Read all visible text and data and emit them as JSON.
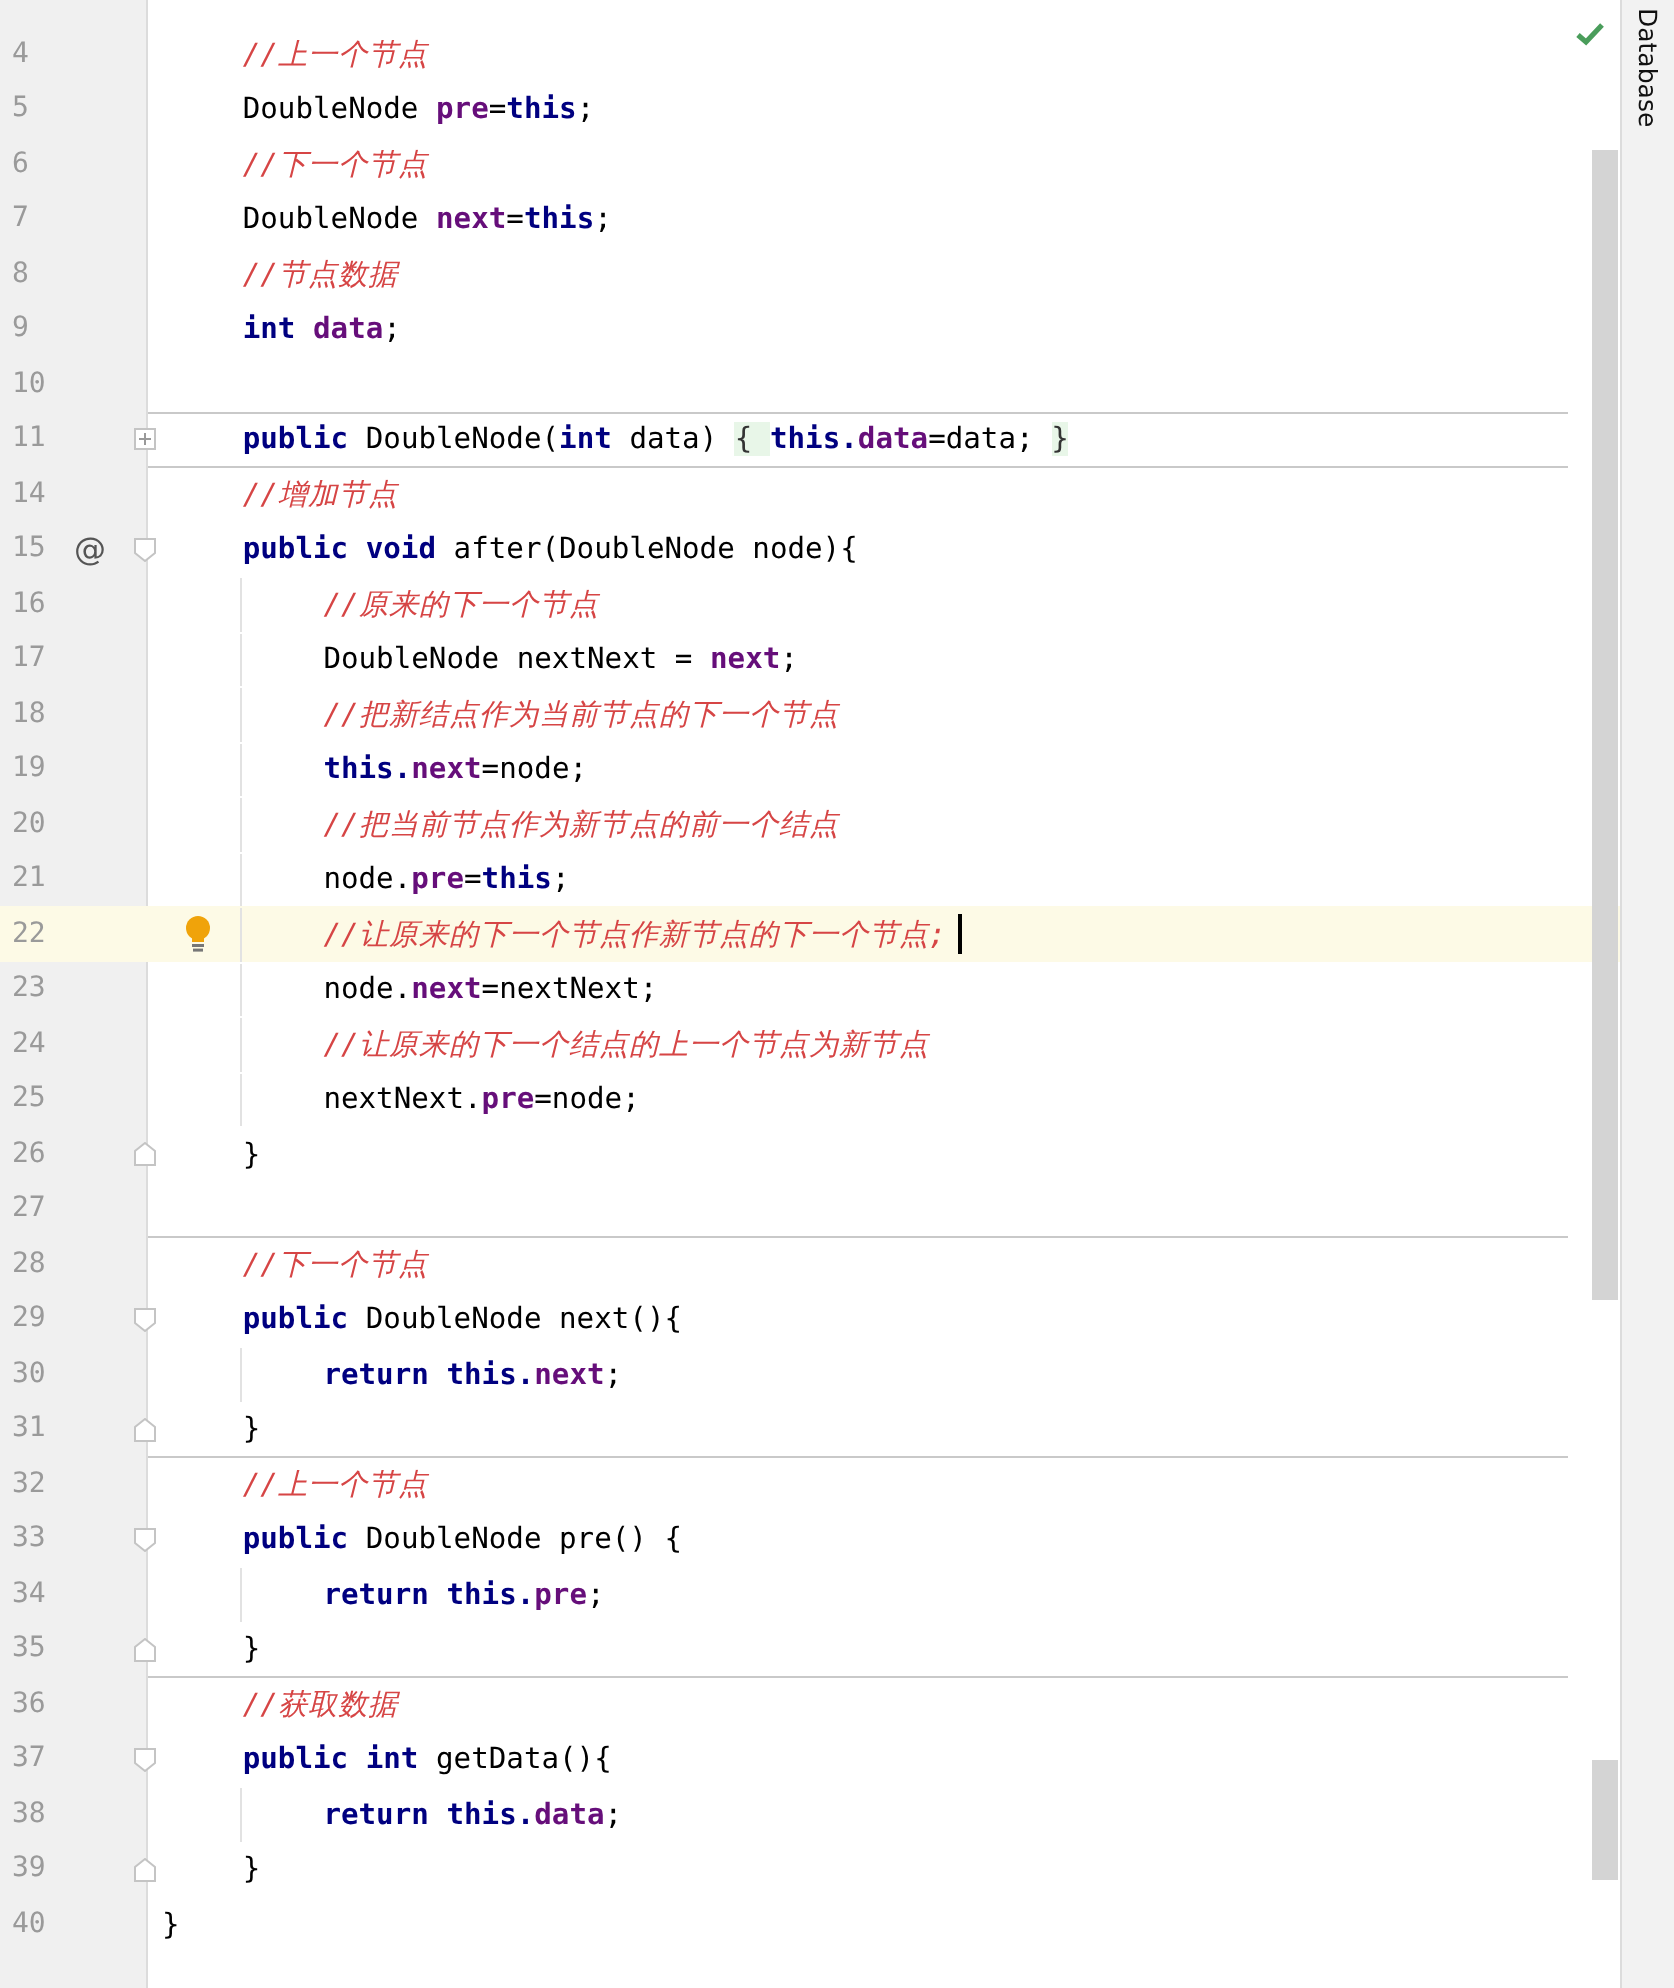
{
  "editor": {
    "lines": [
      {
        "number": "4",
        "separator_above": false,
        "current": false,
        "tokens": [
          {
            "kind": "comment",
            "text": "    //上一个节点"
          }
        ]
      },
      {
        "number": "5",
        "separator_above": false,
        "current": false,
        "tokens": [
          {
            "kind": "plain",
            "text": "    DoubleNode "
          },
          {
            "kind": "field",
            "text": "pre"
          },
          {
            "kind": "plain",
            "text": "="
          },
          {
            "kind": "keyword",
            "text": "this"
          },
          {
            "kind": "plain",
            "text": ";"
          }
        ]
      },
      {
        "number": "6",
        "separator_above": false,
        "current": false,
        "tokens": [
          {
            "kind": "comment",
            "text": "    //下一个节点"
          }
        ]
      },
      {
        "number": "7",
        "separator_above": false,
        "current": false,
        "tokens": [
          {
            "kind": "plain",
            "text": "    DoubleNode "
          },
          {
            "kind": "field",
            "text": "next"
          },
          {
            "kind": "plain",
            "text": "="
          },
          {
            "kind": "keyword",
            "text": "this"
          },
          {
            "kind": "plain",
            "text": ";"
          }
        ]
      },
      {
        "number": "8",
        "separator_above": false,
        "current": false,
        "tokens": [
          {
            "kind": "comment",
            "text": "    //节点数据"
          }
        ]
      },
      {
        "number": "9",
        "separator_above": false,
        "current": false,
        "tokens": [
          {
            "kind": "keyword",
            "text": "    int "
          },
          {
            "kind": "field",
            "text": "data"
          },
          {
            "kind": "plain",
            "text": ";"
          }
        ]
      },
      {
        "number": "10",
        "separator_above": false,
        "current": false
      },
      {
        "number": "11",
        "separator_above": true,
        "current": false,
        "fold": {
          "kind": "collapsed"
        },
        "tokens": [
          {
            "kind": "keyword",
            "text": "    public "
          },
          {
            "kind": "plain",
            "text": "DoubleNode("
          },
          {
            "kind": "keyword",
            "text": "int "
          },
          {
            "kind": "plain",
            "text": "data) "
          },
          {
            "kind": "folded",
            "text": "{ "
          },
          {
            "kind": "keyword",
            "text": "this."
          },
          {
            "kind": "field",
            "text": "data"
          },
          {
            "kind": "plain",
            "text": "=data; "
          },
          {
            "kind": "folded",
            "text": "}"
          }
        ]
      },
      {
        "number": "14",
        "separator_above": true,
        "current": false,
        "tokens": [
          {
            "kind": "comment",
            "text": "    //增加节点"
          }
        ]
      },
      {
        "number": "15",
        "separator_above": false,
        "current": false,
        "gutter_mark": "@",
        "fold": {
          "kind": "start"
        },
        "tokens": [
          {
            "kind": "keyword",
            "text": "    public void "
          },
          {
            "kind": "plain",
            "text": "after(DoubleNode node){"
          }
        ]
      },
      {
        "number": "16",
        "separator_above": false,
        "current": false,
        "tokens": [
          {
            "kind": "comment",
            "text": "        //原来的下一个节点"
          }
        ]
      },
      {
        "number": "17",
        "separator_above": false,
        "current": false,
        "tokens": [
          {
            "kind": "plain",
            "text": "        DoubleNode nextNext = "
          },
          {
            "kind": "field",
            "text": "next"
          },
          {
            "kind": "plain",
            "text": ";"
          }
        ]
      },
      {
        "number": "18",
        "separator_above": false,
        "current": false,
        "tokens": [
          {
            "kind": "comment",
            "text": "        //把新结点作为当前节点的下一个节点"
          }
        ]
      },
      {
        "number": "19",
        "separator_above": false,
        "current": false,
        "tokens": [
          {
            "kind": "keyword",
            "text": "        this."
          },
          {
            "kind": "field",
            "text": "next"
          },
          {
            "kind": "plain",
            "text": "=node;"
          }
        ]
      },
      {
        "number": "20",
        "separator_above": false,
        "current": false,
        "tokens": [
          {
            "kind": "comment",
            "text": "        //把当前节点作为新节点的前一个结点"
          }
        ]
      },
      {
        "number": "21",
        "separator_above": false,
        "current": false,
        "tokens": [
          {
            "kind": "plain",
            "text": "        node."
          },
          {
            "kind": "field",
            "text": "pre"
          },
          {
            "kind": "plain",
            "text": "="
          },
          {
            "kind": "keyword",
            "text": "this"
          },
          {
            "kind": "plain",
            "text": ";"
          }
        ]
      },
      {
        "number": "22",
        "separator_above": false,
        "current": true,
        "bulb": true,
        "tokens": [
          {
            "kind": "comment",
            "text": "        //让原来的下一个节点作新节点的下一个节点;"
          }
        ]
      },
      {
        "number": "23",
        "separator_above": false,
        "current": false,
        "tokens": [
          {
            "kind": "plain",
            "text": "        node."
          },
          {
            "kind": "field",
            "text": "next"
          },
          {
            "kind": "plain",
            "text": "=nextNext;"
          }
        ]
      },
      {
        "number": "24",
        "separator_above": false,
        "current": false,
        "tokens": [
          {
            "kind": "comment",
            "text": "        //让原来的下一个结点的上一个节点为新节点"
          }
        ]
      },
      {
        "number": "25",
        "separator_above": false,
        "current": false,
        "tokens": [
          {
            "kind": "plain",
            "text": "        nextNext."
          },
          {
            "kind": "field",
            "text": "pre"
          },
          {
            "kind": "plain",
            "text": "=node;"
          }
        ]
      },
      {
        "number": "26",
        "separator_above": false,
        "current": false,
        "fold": {
          "kind": "end"
        },
        "tokens": [
          {
            "kind": "plain",
            "text": "    }"
          }
        ]
      },
      {
        "number": "27",
        "separator_above": false,
        "current": false
      },
      {
        "number": "28",
        "separator_above": true,
        "current": false,
        "tokens": [
          {
            "kind": "comment",
            "text": "    //下一个节点"
          }
        ]
      },
      {
        "number": "29",
        "separator_above": false,
        "current": false,
        "fold": {
          "kind": "start"
        },
        "tokens": [
          {
            "kind": "keyword",
            "text": "    public "
          },
          {
            "kind": "plain",
            "text": "DoubleNode next(){"
          }
        ]
      },
      {
        "number": "30",
        "separator_above": false,
        "current": false,
        "tokens": [
          {
            "kind": "keyword",
            "text": "        return this."
          },
          {
            "kind": "field",
            "text": "next"
          },
          {
            "kind": "plain",
            "text": ";"
          }
        ]
      },
      {
        "number": "31",
        "separator_above": false,
        "current": false,
        "fold": {
          "kind": "end"
        },
        "tokens": [
          {
            "kind": "plain",
            "text": "    }"
          }
        ]
      },
      {
        "number": "32",
        "separator_above": true,
        "current": false,
        "tokens": [
          {
            "kind": "comment",
            "text": "    //上一个节点"
          }
        ]
      },
      {
        "number": "33",
        "separator_above": false,
        "current": false,
        "fold": {
          "kind": "start"
        },
        "tokens": [
          {
            "kind": "keyword",
            "text": "    public "
          },
          {
            "kind": "plain",
            "text": "DoubleNode pre() {"
          }
        ]
      },
      {
        "number": "34",
        "separator_above": false,
        "current": false,
        "tokens": [
          {
            "kind": "keyword",
            "text": "        return this."
          },
          {
            "kind": "field",
            "text": "pre"
          },
          {
            "kind": "plain",
            "text": ";"
          }
        ]
      },
      {
        "number": "35",
        "separator_above": false,
        "current": false,
        "fold": {
          "kind": "end"
        },
        "tokens": [
          {
            "kind": "plain",
            "text": "    }"
          }
        ]
      },
      {
        "number": "36",
        "separator_above": true,
        "current": false,
        "tokens": [
          {
            "kind": "comment",
            "text": "    //获取数据"
          }
        ]
      },
      {
        "number": "37",
        "separator_above": false,
        "current": false,
        "fold": {
          "kind": "start"
        },
        "tokens": [
          {
            "kind": "keyword",
            "text": "    public int "
          },
          {
            "kind": "plain",
            "text": "getData(){"
          }
        ]
      },
      {
        "number": "38",
        "separator_above": false,
        "current": false,
        "tokens": [
          {
            "kind": "keyword",
            "text": "        return this."
          },
          {
            "kind": "field",
            "text": "data"
          },
          {
            "kind": "plain",
            "text": ";"
          }
        ]
      },
      {
        "number": "39",
        "separator_above": false,
        "current": false,
        "fold": {
          "kind": "end"
        },
        "tokens": [
          {
            "kind": "plain",
            "text": "    }"
          }
        ]
      },
      {
        "number": "40",
        "separator_above": false,
        "current": false,
        "tokens": [
          {
            "kind": "plain",
            "text": "}"
          }
        ]
      }
    ]
  },
  "tool_window_strip": {
    "label": "Database"
  }
}
